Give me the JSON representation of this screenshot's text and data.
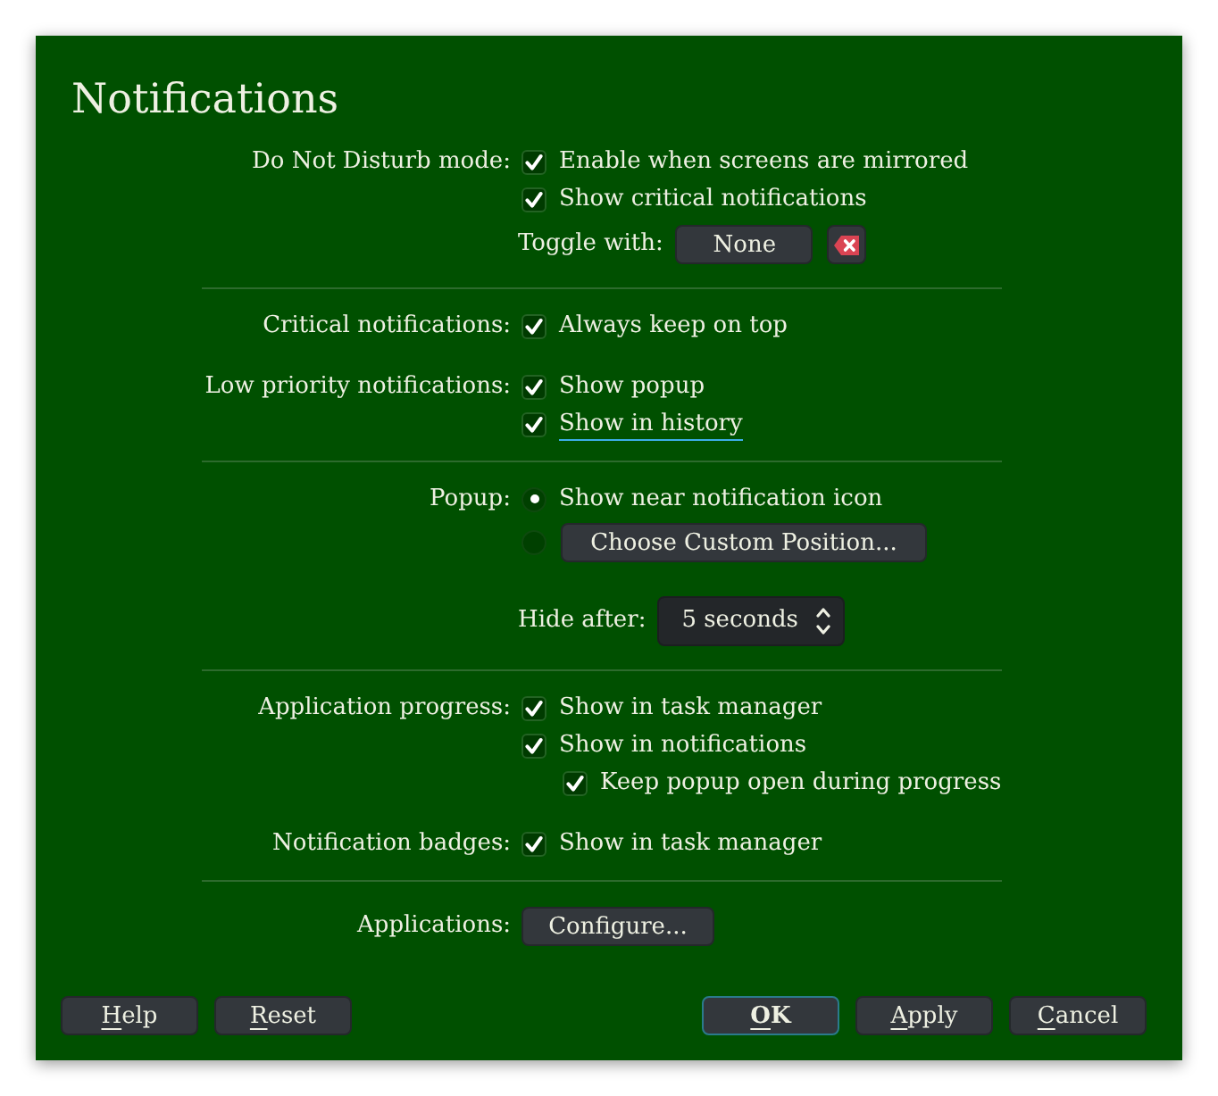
{
  "window": {
    "title": "Notifications"
  },
  "sections": [
    {
      "groups": [
        {
          "label": "Do Not Disturb mode:",
          "items": [
            {
              "kind": "checkbox",
              "text": "Enable when screens are mirrored",
              "checked": true,
              "focused": false
            },
            {
              "kind": "checkbox",
              "text": "Show critical notifications",
              "checked": true,
              "focused": false
            },
            {
              "kind": "shortcut",
              "label": "Toggle with:",
              "value": "None"
            }
          ]
        }
      ]
    },
    {
      "groups": [
        {
          "label": "Critical notifications:",
          "items": [
            {
              "kind": "checkbox",
              "text": "Always keep on top",
              "checked": true,
              "focused": false
            }
          ]
        },
        {
          "label": "Low priority notifications:",
          "items": [
            {
              "kind": "checkbox",
              "text": "Show popup",
              "checked": true,
              "focused": false
            },
            {
              "kind": "checkbox",
              "text": "Show in history",
              "checked": true,
              "focused": true
            }
          ]
        }
      ]
    },
    {
      "groups": [
        {
          "label": "Popup:",
          "items": [
            {
              "kind": "radio",
              "text": "Show near notification icon",
              "selected": true
            },
            {
              "kind": "radio_button",
              "button": "Choose Custom Position...",
              "selected": false
            },
            {
              "kind": "spinbox",
              "label": "Hide after:",
              "value": "5 seconds"
            }
          ]
        }
      ]
    },
    {
      "groups": [
        {
          "label": "Application progress:",
          "items": [
            {
              "kind": "checkbox",
              "text": "Show in task manager",
              "checked": true,
              "focused": false
            },
            {
              "kind": "checkbox",
              "text": "Show in notifications",
              "checked": true,
              "focused": false,
              "children": [
                {
                  "kind": "checkbox",
                  "text": "Keep popup open during progress",
                  "checked": true,
                  "focused": false
                }
              ]
            }
          ]
        },
        {
          "label": "Notification badges:",
          "items": [
            {
              "kind": "checkbox",
              "text": "Show in task manager",
              "checked": true,
              "focused": false
            }
          ]
        }
      ]
    },
    {
      "groups": [
        {
          "label": "Applications:",
          "items": [
            {
              "kind": "button",
              "text": "Configure..."
            }
          ]
        }
      ]
    }
  ],
  "footer": {
    "left_buttons": [
      {
        "label": "Help",
        "mnemonic": true,
        "default": false
      },
      {
        "label": "Reset",
        "mnemonic": true,
        "default": false
      }
    ],
    "right_buttons": [
      {
        "label": "OK",
        "mnemonic": true,
        "default": true
      },
      {
        "label": "Apply",
        "mnemonic": true,
        "default": false
      },
      {
        "label": "Cancel",
        "mnemonic": true,
        "default": false
      }
    ]
  }
}
